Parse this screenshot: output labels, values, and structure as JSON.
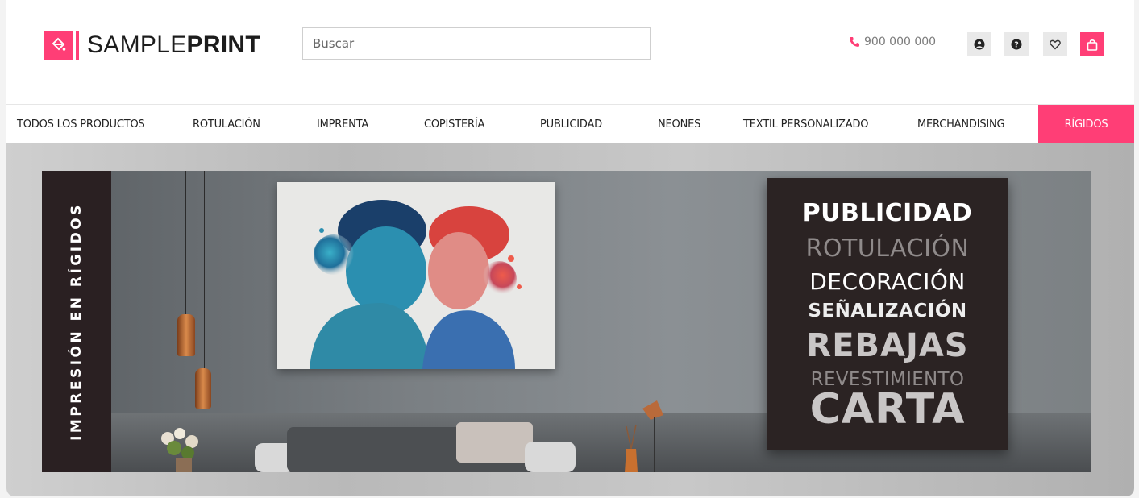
{
  "brand": {
    "name_light": "SAMPLE",
    "name_bold": "PRINT",
    "accent": "#ff3e76"
  },
  "search": {
    "placeholder": "Buscar"
  },
  "header": {
    "phone": "900 000 000",
    "icons": [
      "user-icon",
      "help-icon",
      "heart-icon",
      "bag-icon"
    ]
  },
  "nav": {
    "items": [
      {
        "label": "TODOS LOS PRODUCTOS"
      },
      {
        "label": "ROTULACIÓN"
      },
      {
        "label": "IMPRENTA"
      },
      {
        "label": "COPISTERÍA"
      },
      {
        "label": "PUBLICIDAD"
      },
      {
        "label": "NEONES"
      },
      {
        "label": "TEXTIL PERSONALIZADO"
      },
      {
        "label": "MERCHANDISING"
      },
      {
        "label": "RÍGIDOS"
      }
    ],
    "active": "RÍGIDOS"
  },
  "hero": {
    "side_title": "IMPRESIÓN EN RÍGIDOS",
    "panel_words": [
      "PUBLICIDAD",
      "ROTULACIÓN",
      "DECORACIÓN",
      "SEÑALIZACIÓN",
      "REBAJAS",
      "REVESTIMIENTO",
      "CARTA"
    ]
  }
}
